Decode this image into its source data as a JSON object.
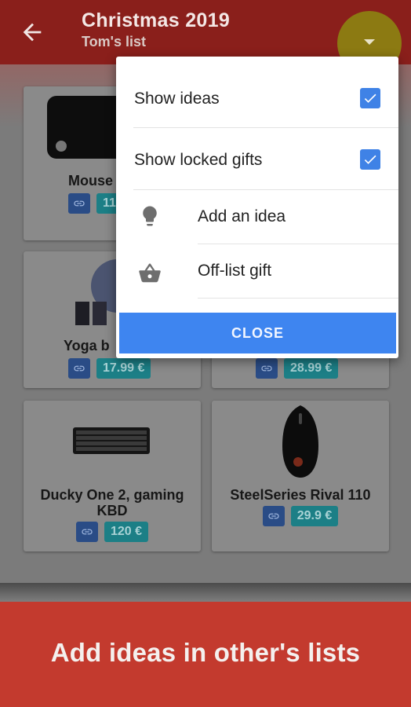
{
  "header": {
    "title": "Christmas 2019",
    "subtitle": "Tom's list",
    "back_icon": "arrow-left-icon",
    "fab_icon": "caret-down-icon"
  },
  "gifts": [
    {
      "name": "Mouse",
      "price": "11",
      "image": "mousepad"
    },
    {
      "name": "Yoga b",
      "price": "17.99 €",
      "image": "yoga-ball"
    },
    {
      "name": "",
      "price": "28.99 €",
      "image": ""
    },
    {
      "name": "Ducky One 2, gaming KBD",
      "price": "120 €",
      "image": "keyboard"
    },
    {
      "name": "SteelSeries Rival 110",
      "price": "29.9 €",
      "image": "gaming-mouse"
    }
  ],
  "menu": {
    "show_ideas": {
      "label": "Show ideas",
      "checked": true
    },
    "show_locked": {
      "label": "Show locked gifts",
      "checked": true
    },
    "add_idea": {
      "label": "Add an idea",
      "icon": "lightbulb-icon"
    },
    "off_list": {
      "label": "Off-list gift",
      "icon": "basket-icon"
    },
    "close_label": "CLOSE"
  },
  "promo": {
    "text": "Add ideas in other's lists"
  },
  "colors": {
    "appbar": "#8a1f1b",
    "accent_blue": "#3e85f0",
    "promo_red": "#c33a2e",
    "price_teal": "#1c7f86"
  }
}
